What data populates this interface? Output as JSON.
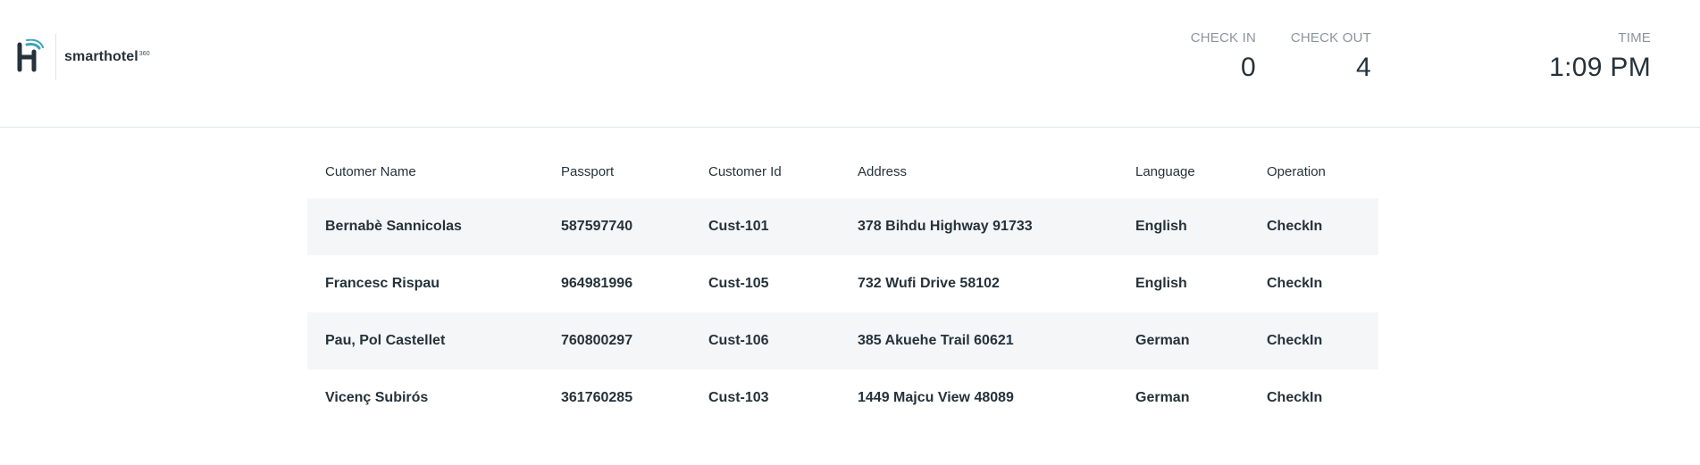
{
  "brand": {
    "name": "smarthotel",
    "superscript": "360"
  },
  "stats": {
    "check_in": {
      "label": "CHECK IN",
      "value": "0"
    },
    "check_out": {
      "label": "CHECK OUT",
      "value": "4"
    },
    "time": {
      "label": "TIME",
      "value": "1:09 PM"
    }
  },
  "table": {
    "headers": [
      "Cutomer Name",
      "Passport",
      "Customer Id",
      "Address",
      "Language",
      "Operation"
    ],
    "rows": [
      [
        "Bernabè Sannicolas",
        "587597740",
        "Cust-101",
        "378 Bihdu Highway 91733",
        "English",
        "CheckIn"
      ],
      [
        "Francesc Rispau",
        "964981996",
        "Cust-105",
        "732 Wufi Drive 58102",
        "English",
        "CheckIn"
      ],
      [
        "Pau, Pol Castellet",
        "760800297",
        "Cust-106",
        "385 Akuehe Trail 60621",
        "German",
        "CheckIn"
      ],
      [
        "Vicenç Subirós",
        "361760285",
        "Cust-103",
        "1449 Majcu View 48089",
        "German",
        "CheckIn"
      ]
    ]
  },
  "colors": {
    "text": "#26323b",
    "muted": "#8a949c",
    "row_alt": "#f4f6f8",
    "accent": "#3aa3b8"
  },
  "icons": {
    "logo": "smarthotel-logo-icon"
  }
}
